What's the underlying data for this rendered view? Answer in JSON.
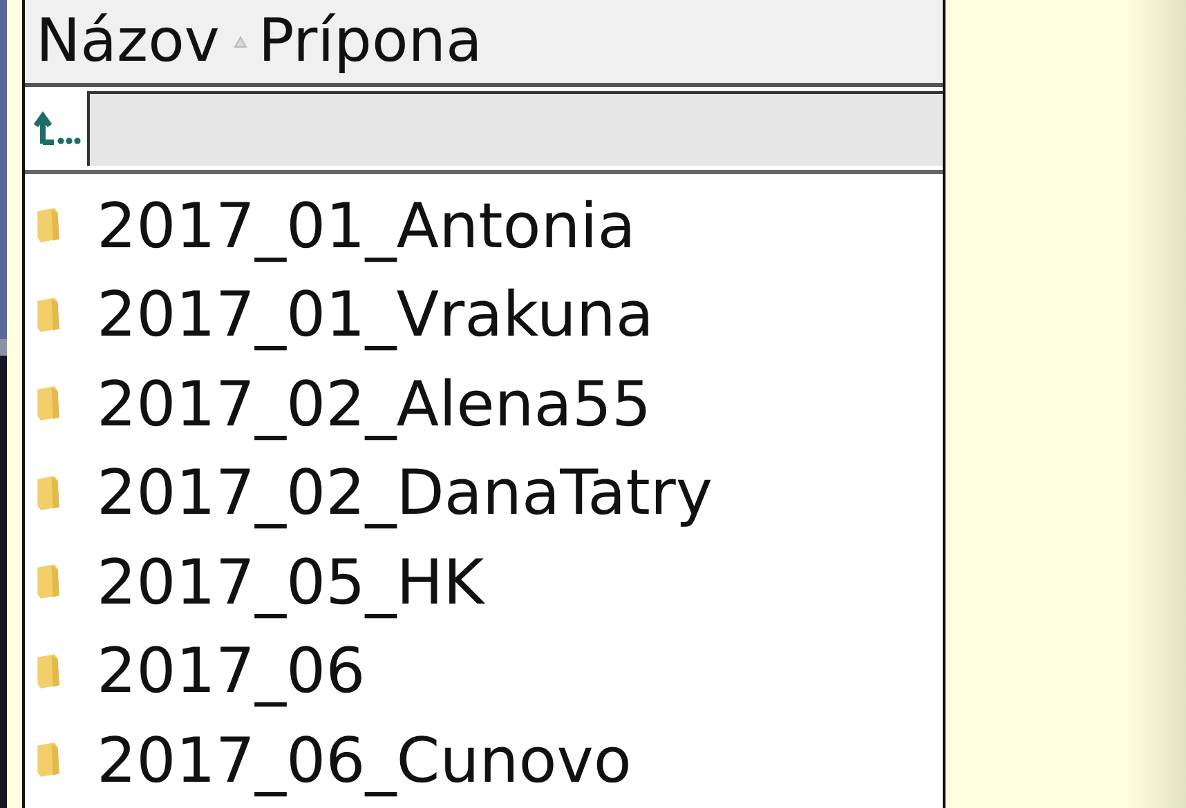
{
  "columns": [
    {
      "label": "Názov",
      "sorted": true
    },
    {
      "label": "Prípona",
      "sorted": false
    }
  ],
  "files": [
    {
      "name": "2017_01_Antonia",
      "kind": "folder"
    },
    {
      "name": "2017_01_Vrakuna",
      "kind": "folder"
    },
    {
      "name": "2017_02_Alena55",
      "kind": "folder"
    },
    {
      "name": "2017_02_DanaTatry",
      "kind": "folder"
    },
    {
      "name": "2017_05_HK",
      "kind": "folder"
    },
    {
      "name": "2017_06",
      "kind": "folder"
    },
    {
      "name": "2017_06_Cunovo",
      "kind": "folder"
    }
  ]
}
